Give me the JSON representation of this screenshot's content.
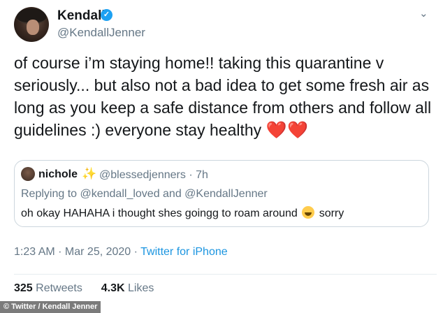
{
  "tweet": {
    "display_name": "Kendall",
    "handle": "@KendallJenner",
    "text": "of course i’m staying home!! taking this quarantine v seriously... but also not a bad idea to get some fresh air as long as you keep a safe distance from others and follow all guidelines :) everyone stay healthy",
    "hearts": "❤️❤️",
    "time": "1:23 AM",
    "date": "Mar 25, 2020",
    "source": "Twitter for iPhone",
    "retweets_count": "325",
    "retweets_label": "Retweets",
    "likes_count": "4.3K",
    "likes_label": "Likes"
  },
  "quoted": {
    "name": "nichole",
    "handle": "@blessedjenners",
    "age": "7h",
    "reply_line": "Replying to @kendall_loved and @KendallJenner",
    "text_before": "oh okay HAHAHA i thought shes goingg to roam around",
    "text_after": "sorry"
  },
  "credit": "© Twitter / Kendall Jenner",
  "icons": {
    "verified": "verified-badge-icon",
    "more": "chevron-down-icon",
    "sparkle": "sparkles-emoji",
    "laugh": "tears-of-joy-emoji"
  },
  "colors": {
    "verified": "#1da1f2",
    "link": "#1b95e0",
    "heart": "#e0245e",
    "muted": "#657786"
  }
}
